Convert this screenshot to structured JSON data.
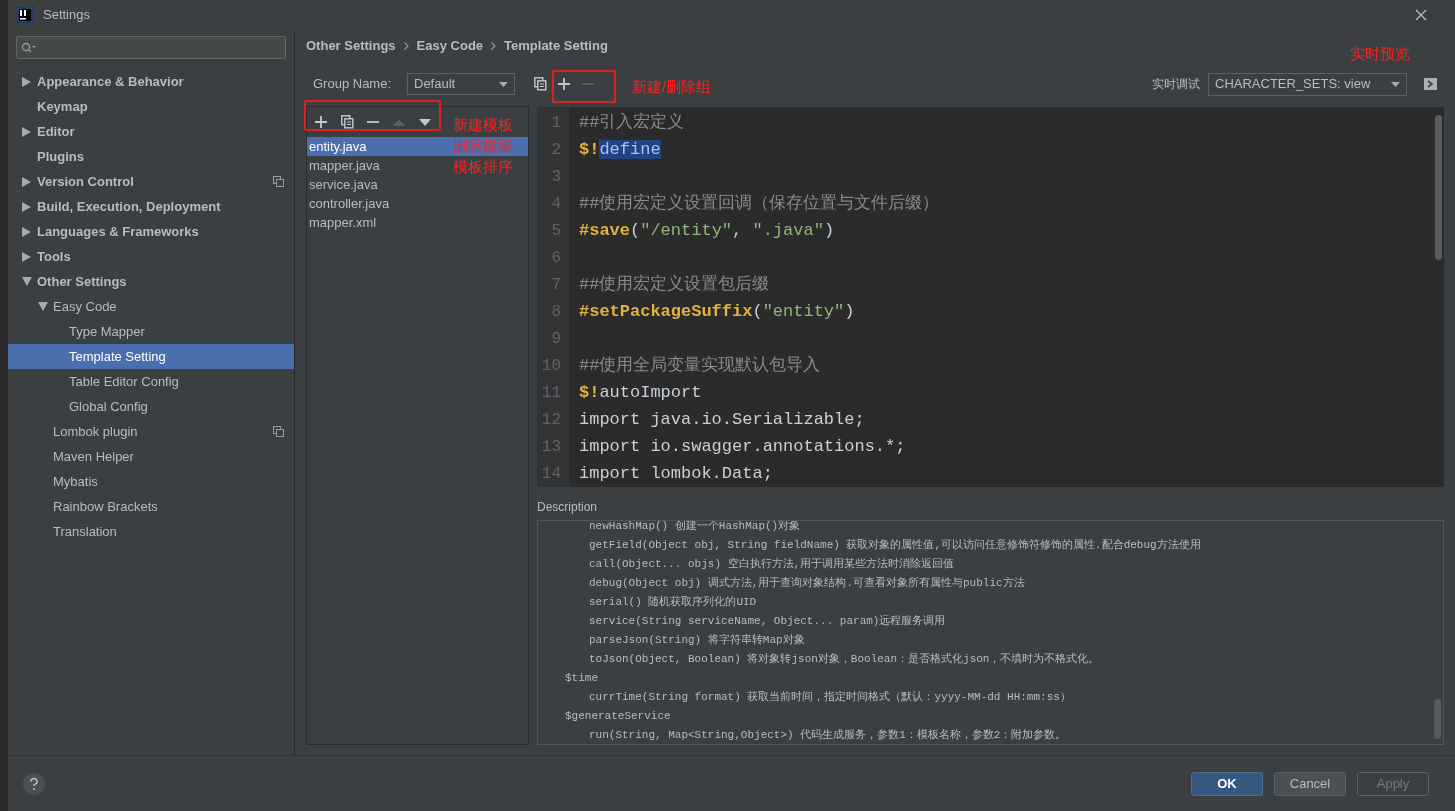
{
  "window": {
    "title": "Settings"
  },
  "sidebar": {
    "tree": [
      {
        "label": "Appearance & Behavior",
        "expanded": false,
        "has_children": true,
        "selected": false,
        "project_scoped": false
      },
      {
        "label": "Keymap",
        "has_children": false,
        "selected": false,
        "project_scoped": false
      },
      {
        "label": "Editor",
        "expanded": false,
        "has_children": true,
        "selected": false,
        "project_scoped": false
      },
      {
        "label": "Plugins",
        "has_children": false,
        "selected": false,
        "project_scoped": false
      },
      {
        "label": "Version Control",
        "expanded": false,
        "has_children": true,
        "selected": false,
        "project_scoped": true
      },
      {
        "label": "Build, Execution, Deployment",
        "expanded": false,
        "has_children": true,
        "selected": false,
        "project_scoped": false
      },
      {
        "label": "Languages & Frameworks",
        "expanded": false,
        "has_children": true,
        "selected": false,
        "project_scoped": false
      },
      {
        "label": "Tools",
        "expanded": false,
        "has_children": true,
        "selected": false,
        "project_scoped": false
      },
      {
        "label": "Other Settings",
        "expanded": true,
        "has_children": true,
        "selected": false,
        "project_scoped": false,
        "children": [
          {
            "label": "Easy Code",
            "expanded": true,
            "has_children": true,
            "selected": false,
            "project_scoped": false,
            "children": [
              {
                "label": "Type Mapper",
                "has_children": false,
                "selected": false,
                "project_scoped": false
              },
              {
                "label": "Template Setting",
                "has_children": false,
                "selected": true,
                "project_scoped": false
              },
              {
                "label": "Table Editor Config",
                "has_children": false,
                "selected": false,
                "project_scoped": false
              },
              {
                "label": "Global Config",
                "has_children": false,
                "selected": false,
                "project_scoped": false
              }
            ]
          },
          {
            "label": "Lombok plugin",
            "has_children": false,
            "selected": false,
            "project_scoped": true
          },
          {
            "label": "Maven Helper",
            "has_children": false,
            "selected": false,
            "project_scoped": false
          },
          {
            "label": "Mybatis",
            "has_children": false,
            "selected": false,
            "project_scoped": false
          },
          {
            "label": "Rainbow Brackets",
            "has_children": false,
            "selected": false,
            "project_scoped": false
          },
          {
            "label": "Translation",
            "has_children": false,
            "selected": false,
            "project_scoped": false
          }
        ]
      }
    ]
  },
  "breadcrumb": [
    "Other Settings",
    "Easy Code",
    "Template Setting"
  ],
  "group": {
    "label": "Group Name:",
    "value": "Default",
    "tools": [
      {
        "kind": "copy",
        "disabled": false
      },
      {
        "kind": "add",
        "disabled": false
      },
      {
        "kind": "remove",
        "disabled": true
      }
    ]
  },
  "debug": {
    "label": "实时调试",
    "value": "CHARACTER_SETS: view"
  },
  "templates": {
    "tools": [
      {
        "kind": "add",
        "disabled": false
      },
      {
        "kind": "copy",
        "disabled": false
      },
      {
        "kind": "remove",
        "disabled": false
      },
      {
        "kind": "up",
        "disabled": true
      },
      {
        "kind": "down",
        "disabled": false
      }
    ],
    "items": [
      {
        "label": "entity.java",
        "selected": true
      },
      {
        "label": "mapper.java",
        "selected": false
      },
      {
        "label": "service.java",
        "selected": false
      },
      {
        "label": "controller.java",
        "selected": false
      },
      {
        "label": "mapper.xml",
        "selected": false
      }
    ]
  },
  "editor": {
    "lines": [
      {
        "number": "1",
        "tokens": [
          {
            "kind": "comment",
            "text": "##引入宏定义"
          }
        ]
      },
      {
        "number": "2",
        "tokens": [
          {
            "kind": "directive",
            "text": "$!"
          },
          {
            "kind": "selected",
            "text": "define"
          }
        ]
      },
      {
        "number": "3"
      },
      {
        "number": "4",
        "tokens": [
          {
            "kind": "comment",
            "text": "##使用宏定义设置回调（保存位置与文件后缀）"
          }
        ]
      },
      {
        "number": "5",
        "tokens": [
          {
            "kind": "directive",
            "text": "#save"
          },
          {
            "kind": "plain",
            "text": "("
          },
          {
            "kind": "string",
            "text": "\"/entity\""
          },
          {
            "kind": "plain",
            "text": ", "
          },
          {
            "kind": "string",
            "text": "\".java\""
          },
          {
            "kind": "plain",
            "text": ")"
          }
        ]
      },
      {
        "number": "6"
      },
      {
        "number": "7",
        "tokens": [
          {
            "kind": "comment",
            "text": "##使用宏定义设置包后缀"
          }
        ]
      },
      {
        "number": "8",
        "tokens": [
          {
            "kind": "directive",
            "text": "#setPackageSuffix"
          },
          {
            "kind": "plain",
            "text": "("
          },
          {
            "kind": "string",
            "text": "\"entity\""
          },
          {
            "kind": "plain",
            "text": ")"
          }
        ]
      },
      {
        "number": "9"
      },
      {
        "number": "10",
        "tokens": [
          {
            "kind": "comment",
            "text": "##使用全局变量实现默认包导入"
          }
        ]
      },
      {
        "number": "11",
        "tokens": [
          {
            "kind": "directive",
            "text": "$!"
          },
          {
            "kind": "plain",
            "text": "autoImport"
          }
        ]
      },
      {
        "number": "12",
        "tokens": [
          {
            "kind": "plain",
            "text": "import java.io.Serializable;"
          }
        ]
      },
      {
        "number": "13",
        "tokens": [
          {
            "kind": "plain",
            "text": "import io.swagger.annotations.*;"
          }
        ]
      },
      {
        "number": "14",
        "tokens": [
          {
            "kind": "plain",
            "text": "import lombok.Data;"
          }
        ]
      }
    ]
  },
  "description": {
    "label": "Description",
    "lines": [
      {
        "kind": "entry",
        "text": "newHashMap() 创建一个HashMap()对象"
      },
      {
        "kind": "entry",
        "text": "getField(Object obj, String fieldName) 获取对象的属性值,可以访问任意修饰符修饰的属性.配合debug方法使用"
      },
      {
        "kind": "entry",
        "text": "call(Object... objs) 空白执行方法,用于调用某些方法时消除返回值"
      },
      {
        "kind": "entry",
        "text": "debug(Object obj) 调式方法,用于查询对象结构.可查看对象所有属性与public方法"
      },
      {
        "kind": "entry",
        "text": "serial() 随机获取序列化的UID"
      },
      {
        "kind": "entry",
        "text": "service(String serviceName, Object... param)远程服务调用"
      },
      {
        "kind": "entry",
        "text": "parseJson(String) 将字符串转Map对象"
      },
      {
        "kind": "entry",
        "text": "toJson(Object, Boolean) 将对象转json对象，Boolean：是否格式化json，不填时为不格式化。"
      },
      {
        "kind": "heading",
        "text": "$time"
      },
      {
        "kind": "entry",
        "text": "currTime(String format) 获取当前时间，指定时间格式（默认：yyyy-MM-dd HH:mm:ss）"
      },
      {
        "kind": "heading",
        "text": "$generateService"
      },
      {
        "kind": "entry",
        "text": "run(String, Map<String,Object>) 代码生成服务，参数1：模板名称，参数2：附加参数。"
      }
    ]
  },
  "annotations": [
    {
      "text": "实时预览"
    },
    {
      "text": "新建/删除组"
    },
    {
      "text": "新建模板"
    },
    {
      "text": "删除模板"
    },
    {
      "text": "模板排序"
    }
  ],
  "buttons": [
    {
      "label": "OK",
      "kind": "primary",
      "disabled": false
    },
    {
      "label": "Cancel",
      "kind": "normal",
      "disabled": false
    },
    {
      "label": "Apply",
      "kind": "normal",
      "disabled": true
    }
  ]
}
